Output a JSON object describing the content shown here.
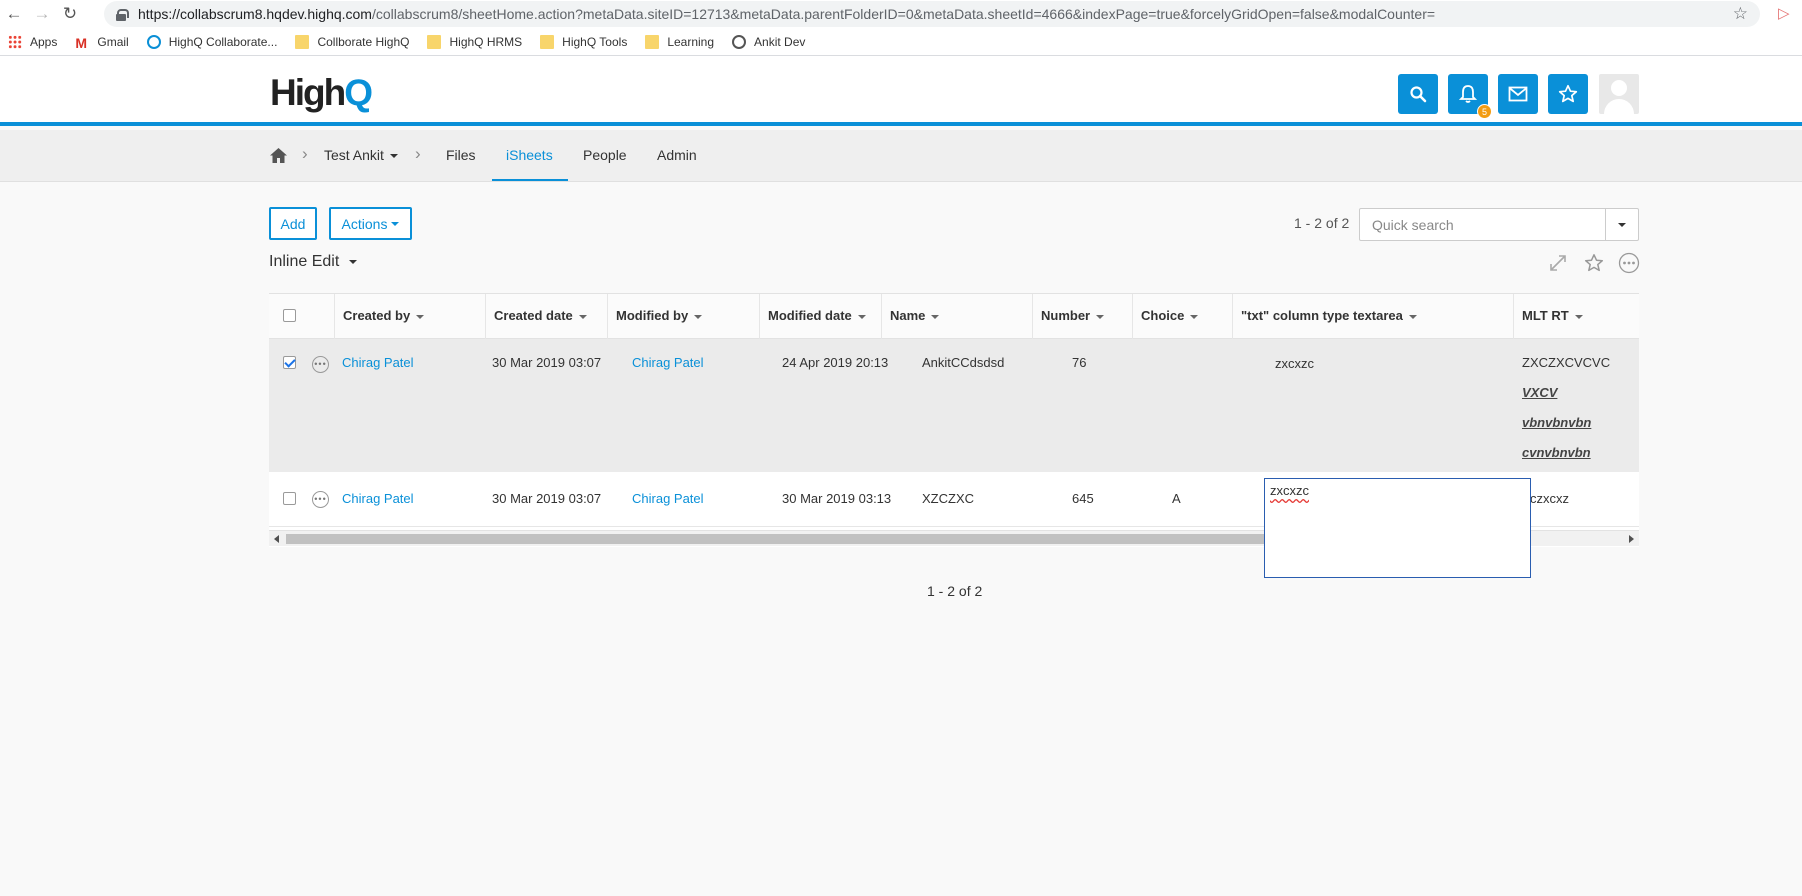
{
  "browser": {
    "url_host": "https://collabscrum8.hqdev.highq.com",
    "url_path": "/collabscrum8/sheetHome.action?metaData.siteID=12713&metaData.parentFolderID=0&metaData.sheetId=4666&indexPage=true&forcelyGridOpen=false&modalCounter=",
    "bookmarks": [
      {
        "label": "Apps",
        "icon": "apps-grid-icon"
      },
      {
        "label": "Gmail",
        "icon": "gmail-icon"
      },
      {
        "label": "HighQ Collaborate...",
        "icon": "highq-icon"
      },
      {
        "label": "Collborate HighQ",
        "icon": "folder-icon"
      },
      {
        "label": "HighQ HRMS",
        "icon": "folder-icon"
      },
      {
        "label": "HighQ Tools",
        "icon": "folder-icon"
      },
      {
        "label": "Learning",
        "icon": "folder-icon"
      },
      {
        "label": "Ankit Dev",
        "icon": "globe-icon"
      }
    ]
  },
  "header": {
    "logo_main": "High",
    "logo_accent": "Q",
    "notifications_count": "5",
    "accent_color": "#0a90d8"
  },
  "subnav": {
    "site_name": "Test Ankit",
    "items": [
      "Files",
      "iSheets",
      "People",
      "Admin"
    ],
    "active": "iSheets"
  },
  "toolbar": {
    "add_label": "Add",
    "actions_label": "Actions",
    "pager_top": "1 - 2 of 2",
    "search_placeholder": "Quick search",
    "view_name": "Inline Edit"
  },
  "grid": {
    "columns": [
      "Created by",
      "Created date",
      "Modified by",
      "Modified date",
      "Name",
      "Number",
      "Choice",
      "\"txt\" column type textarea",
      "MLT RT"
    ],
    "rows": [
      {
        "checked": true,
        "created_by": "Chirag Patel",
        "created_date": "30 Mar 2019 03:07",
        "modified_by": "Chirag Patel",
        "modified_date": "24 Apr 2019 20:13",
        "name": "AnkitCCdsdsd",
        "number": "76",
        "choice": "",
        "txt": "zxcxzc",
        "mlt_rt": [
          "ZXCZXCVCVC",
          "VXCV",
          "vbnvbnvbn",
          "cvnvbnvbn"
        ]
      },
      {
        "checked": false,
        "created_by": "Chirag Patel",
        "created_date": "30 Mar 2019 03:07",
        "modified_by": "Chirag Patel",
        "modified_date": "30 Mar 2019 03:13",
        "name": "XZCZXC",
        "number": "645",
        "choice": "A",
        "txt": "zxcxzc",
        "mlt_rt": [
          "czxcxz"
        ]
      }
    ]
  },
  "pager_bottom": "1 - 2 of 2"
}
